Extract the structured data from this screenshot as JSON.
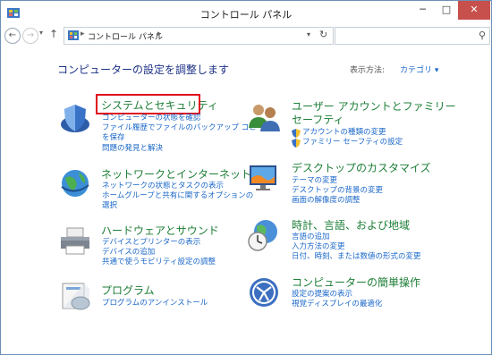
{
  "window": {
    "title": "コントロール パネル",
    "minimize": "─",
    "maximize": "□",
    "close": "✕"
  },
  "nav": {
    "back": "←",
    "forward": "→",
    "recent": "▾",
    "up": "↑"
  },
  "address": {
    "separator": "▸",
    "path": "コントロール パネル",
    "dropdown": "▾",
    "refresh": "↻"
  },
  "search": {
    "placeholder": "",
    "icon": "search-icon"
  },
  "main": {
    "heading": "コンピューターの設定を調整します",
    "viewby_label": "表示方法:",
    "viewby_value": "カテゴリ ▾"
  },
  "categories": {
    "system": {
      "title": "システムとセキュリティ",
      "links": [
        "コンピューターの状態を確認",
        "ファイル履歴でファイルのバックアップ コピー",
        "を保存",
        "問題の発見と解決"
      ]
    },
    "user": {
      "title_line1": "ユーザー アカウントとファミリー",
      "title_line2": "セーフティ",
      "links": [
        "アカウントの種類の変更",
        "ファミリー セーフティの設定"
      ]
    },
    "network": {
      "title": "ネットワークとインターネット",
      "links": [
        "ネットワークの状態とタスクの表示",
        "ホームグループと共有に関するオプションの",
        "選択"
      ]
    },
    "desktop": {
      "title": "デスクトップのカスタマイズ",
      "links": [
        "テーマの変更",
        "デスクトップの背景の変更",
        "画面の解像度の調整"
      ]
    },
    "hardware": {
      "title": "ハードウェアとサウンド",
      "links": [
        "デバイスとプリンターの表示",
        "デバイスの追加",
        "共通で使うモビリティ設定の調整"
      ]
    },
    "clock": {
      "title": "時計、言語、および地域",
      "links": [
        "言語の追加",
        "入力方法の変更",
        "日付、時刻、または数値の形式の変更"
      ]
    },
    "programs": {
      "title": "プログラム",
      "links": [
        "プログラムのアンインストール"
      ]
    },
    "ease": {
      "title": "コンピューターの簡単操作",
      "links": [
        "設定の提案の表示",
        "視覚ディスプレイの最適化"
      ]
    }
  },
  "colors": {
    "category_title": "#1d7e37",
    "link": "#1a67c9",
    "heading": "#1e3287",
    "highlight": "#e0101a"
  }
}
